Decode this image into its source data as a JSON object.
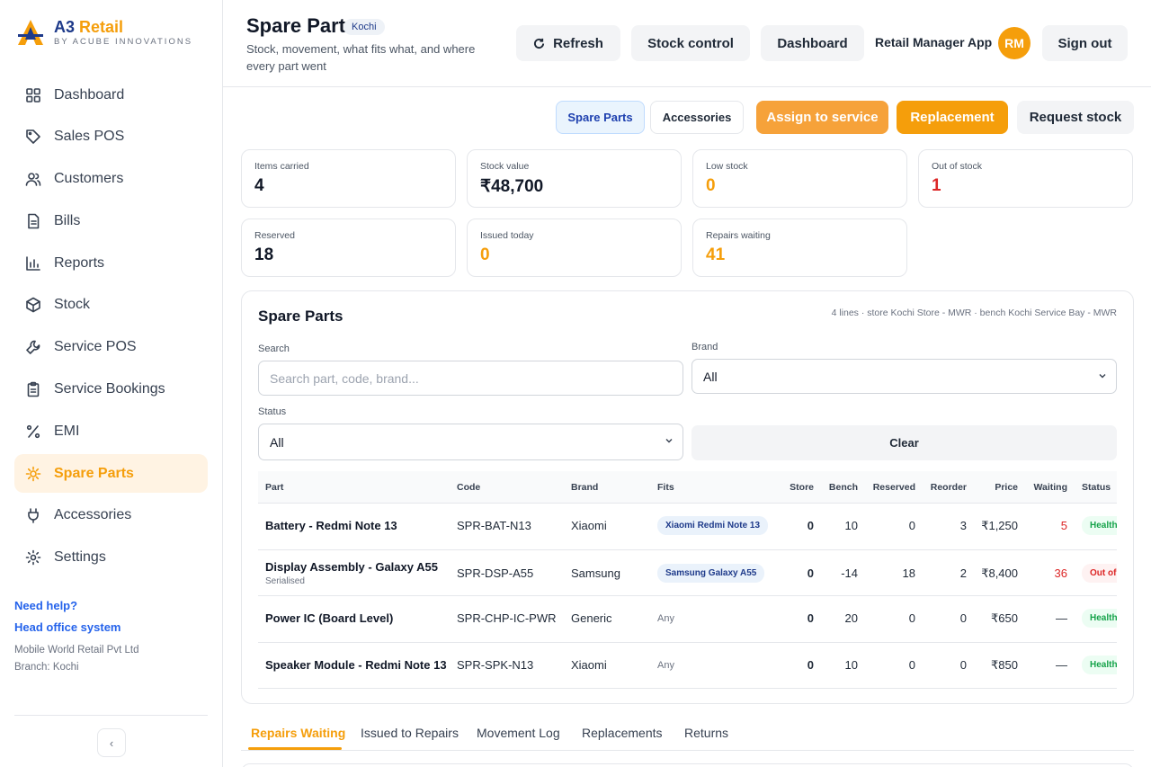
{
  "brand": {
    "name_main": "A3",
    "name_accent": "Retail",
    "tagline": "BY ACUBE INNOVATIONS"
  },
  "sidebar": {
    "items": [
      {
        "label": "Dashboard",
        "icon": "grid-icon"
      },
      {
        "label": "Sales POS",
        "icon": "tag-icon"
      },
      {
        "label": "Customers",
        "icon": "users-icon"
      },
      {
        "label": "Bills",
        "icon": "file-icon"
      },
      {
        "label": "Reports",
        "icon": "bar-chart-icon"
      },
      {
        "label": "Stock",
        "icon": "box-icon"
      },
      {
        "label": "Service POS",
        "icon": "wrench-icon"
      },
      {
        "label": "Service Bookings",
        "icon": "clipboard-icon"
      },
      {
        "label": "EMI",
        "icon": "percent-icon"
      },
      {
        "label": "Spare Parts",
        "icon": "gear-icon",
        "active": true
      },
      {
        "label": "Accessories",
        "icon": "plug-icon"
      },
      {
        "label": "Settings",
        "icon": "settings-icon"
      }
    ],
    "help_link": "Need help?",
    "head_office_link": "Head office system",
    "company": "Mobile World Retail Pvt Ltd",
    "branch": "Branch: Kochi",
    "collapse_glyph": "‹"
  },
  "header": {
    "title": "Spare Parts",
    "branch_chip": "Kochi",
    "subtitle": "Stock, movement, what fits what, and where every part went",
    "refresh_label": "Refresh",
    "stock_control_label": "Stock control",
    "dashboard_label": "Dashboard",
    "app_name": "Retail Manager App",
    "avatar_initials": "RM",
    "signout_label": "Sign out"
  },
  "actions": {
    "spare_parts_tab": "Spare Parts",
    "accessories_tab": "Accessories",
    "assign_label": "Assign to service",
    "replacement_label": "Replacement",
    "request_label": "Request stock"
  },
  "stats": {
    "items_carried": {
      "label": "Items carried",
      "value": "4"
    },
    "stock_value": {
      "label": "Stock value",
      "value": "₹48,700"
    },
    "low_stock": {
      "label": "Low stock",
      "value": "0"
    },
    "out_of_stock": {
      "label": "Out of stock",
      "value": "1"
    },
    "reserved": {
      "label": "Reserved",
      "value": "18"
    },
    "issued_today": {
      "label": "Issued today",
      "value": "0"
    },
    "repairs_waiting": {
      "label": "Repairs waiting",
      "value": "41"
    }
  },
  "panel": {
    "title": "Spare Parts",
    "meta": "4 lines · store Kochi Store - MWR · bench Kochi Service Bay - MWR",
    "search_label": "Search",
    "search_placeholder": "Search part, code, brand...",
    "brand_label": "Brand",
    "brand_value": "All",
    "status_label": "Status",
    "status_value": "All",
    "clear_label": "Clear"
  },
  "table": {
    "headers": {
      "part": "Part",
      "code": "Code",
      "brand": "Brand",
      "fits": "Fits",
      "store": "Store",
      "bench": "Bench",
      "reserved": "Reserved",
      "reorder": "Reorder",
      "price": "Price",
      "waiting": "Waiting",
      "status": "Status"
    },
    "rows": [
      {
        "part": "Battery - Redmi Note 13",
        "sub": "",
        "code": "SPR-BAT-N13",
        "brand": "Xiaomi",
        "fits": "Xiaomi Redmi Note 13",
        "store": "0",
        "bench": "10",
        "reserved": "0",
        "reorder": "3",
        "price": "₹1,250",
        "waiting": "5",
        "status": "Healthy"
      },
      {
        "part": "Display Assembly - Galaxy A55",
        "sub": "Serialised",
        "code": "SPR-DSP-A55",
        "brand": "Samsung",
        "fits": "Samsung Galaxy A55",
        "store": "0",
        "bench": "-14",
        "reserved": "18",
        "reorder": "2",
        "price": "₹8,400",
        "waiting": "36",
        "status": "Out of stock"
      },
      {
        "part": "Power IC (Board Level)",
        "sub": "",
        "code": "SPR-CHP-IC-PWR",
        "brand": "Generic",
        "fits": "Any",
        "store": "0",
        "bench": "20",
        "reserved": "0",
        "reorder": "0",
        "price": "₹650",
        "waiting": "—",
        "status": "Healthy"
      },
      {
        "part": "Speaker Module - Redmi Note 13",
        "sub": "",
        "code": "SPR-SPK-N13",
        "brand": "Xiaomi",
        "fits": "Any",
        "store": "0",
        "bench": "10",
        "reserved": "0",
        "reorder": "0",
        "price": "₹850",
        "waiting": "—",
        "status": "Healthy"
      }
    ]
  },
  "bottom_tabs": [
    "Repairs Waiting",
    "Issued to Repairs",
    "Movement Log",
    "Replacements",
    "Returns"
  ],
  "colors": {
    "accent": "#f59e0b",
    "brand": "#1e3a8a",
    "danger": "#dc2626",
    "success": "#16a34a"
  }
}
